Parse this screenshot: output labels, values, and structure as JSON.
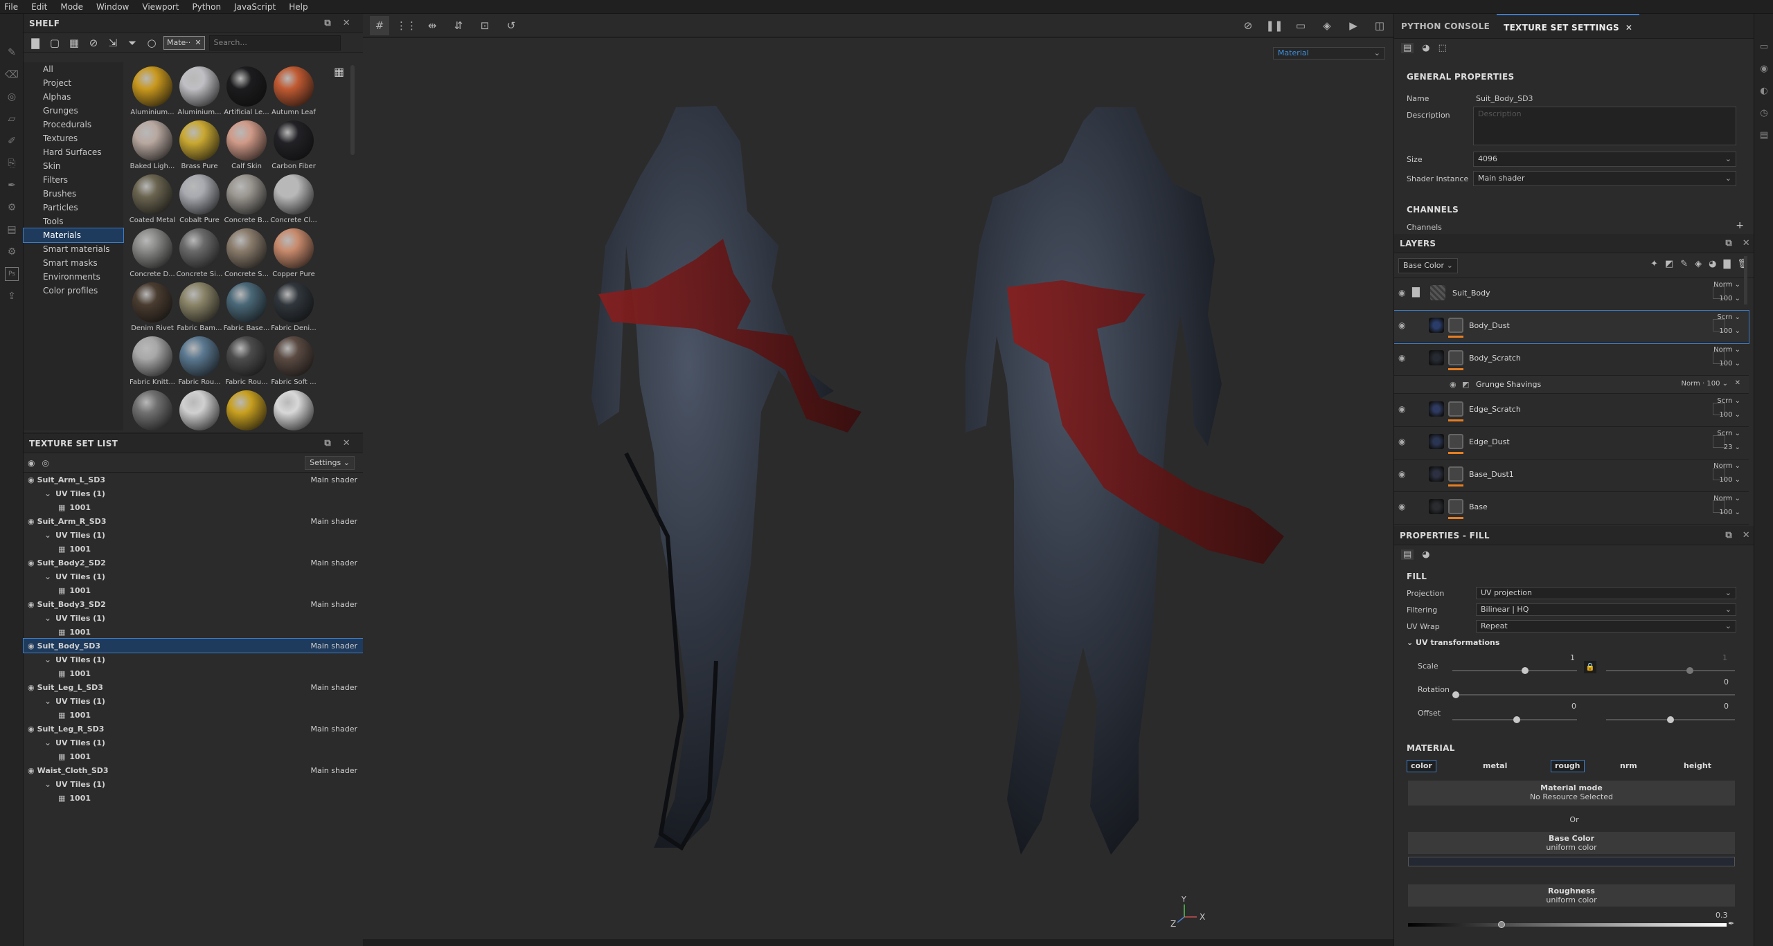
{
  "menu": [
    "File",
    "Edit",
    "Mode",
    "Window",
    "Viewport",
    "Python",
    "JavaScript",
    "Help"
  ],
  "shelf": {
    "title": "SHELF",
    "filter_chip": "Mate··",
    "search_placeholder": "Search...",
    "categories": [
      "All",
      "Project",
      "Alphas",
      "Grunges",
      "Procedurals",
      "Textures",
      "Hard Surfaces",
      "Skin",
      "Filters",
      "Brushes",
      "Particles",
      "Tools",
      "Materials",
      "Smart materials",
      "Smart masks",
      "Environments",
      "Color profiles"
    ],
    "selected_category": "Materials",
    "materials": [
      {
        "label": "Aluminium...",
        "color": "#c9981e"
      },
      {
        "label": "Aluminium...",
        "color": "#c0c0c4"
      },
      {
        "label": "Artificial Le...",
        "color": "#1c1c1e"
      },
      {
        "label": "Autumn Leaf",
        "color": "#c05a32"
      },
      {
        "label": "Baked Ligh...",
        "color": "#b8a8a0"
      },
      {
        "label": "Brass Pure",
        "color": "#c9a832"
      },
      {
        "label": "Calf Skin",
        "color": "#d09a88"
      },
      {
        "label": "Carbon Fiber",
        "color": "#222226"
      },
      {
        "label": "Coated Metal",
        "color": "#6a6450"
      },
      {
        "label": "Cobalt Pure",
        "color": "#a8aab0"
      },
      {
        "label": "Concrete B...",
        "color": "#9a9690"
      },
      {
        "label": "Concrete Cl...",
        "color": "#b8b8b8"
      },
      {
        "label": "Concrete D...",
        "color": "#8a8a88"
      },
      {
        "label": "Concrete Si...",
        "color": "#6a6a6a"
      },
      {
        "label": "Concrete S...",
        "color": "#8a7c6c"
      },
      {
        "label": "Copper Pure",
        "color": "#c88a6c"
      },
      {
        "label": "Denim Rivet",
        "color": "#4a3c30"
      },
      {
        "label": "Fabric Bam...",
        "color": "#8a8468"
      },
      {
        "label": "Fabric Base...",
        "color": "#4a6878"
      },
      {
        "label": "Fabric Deni...",
        "color": "#30363c"
      },
      {
        "label": "Fabric Knitt...",
        "color": "#a8a8a8"
      },
      {
        "label": "Fabric Rou...",
        "color": "#5a7890"
      },
      {
        "label": "Fabric Rou...",
        "color": "#4c4c4c"
      },
      {
        "label": "Fabric Soft ...",
        "color": "#5a4a42"
      },
      {
        "label": "",
        "color": "#707070"
      },
      {
        "label": "",
        "color": "#d0d0d0"
      },
      {
        "label": "",
        "color": "#c8a020"
      },
      {
        "label": "",
        "color": "#d8d8d8"
      }
    ]
  },
  "texture_set_list": {
    "title": "TEXTURE SET LIST",
    "settings_label": "Settings",
    "sets": [
      {
        "name": "Suit_Arm_L_SD3",
        "shader": "Main shader",
        "uv": "UV Tiles (1)",
        "tile": "1001"
      },
      {
        "name": "Suit_Arm_R_SD3",
        "shader": "Main shader",
        "uv": "UV Tiles (1)",
        "tile": "1001"
      },
      {
        "name": "Suit_Body2_SD2",
        "shader": "Main shader",
        "uv": "UV Tiles (1)",
        "tile": "1001"
      },
      {
        "name": "Suit_Body3_SD2",
        "shader": "Main shader",
        "uv": "UV Tiles (1)",
        "tile": "1001"
      },
      {
        "name": "Suit_Body_SD3",
        "shader": "Main shader",
        "uv": "UV Tiles (1)",
        "tile": "1001"
      },
      {
        "name": "Suit_Leg_L_SD3",
        "shader": "Main shader",
        "uv": "UV Tiles (1)",
        "tile": "1001"
      },
      {
        "name": "Suit_Leg_R_SD3",
        "shader": "Main shader",
        "uv": "UV Tiles (1)",
        "tile": "1001"
      },
      {
        "name": "Waist_Cloth_SD3",
        "shader": "Main shader",
        "uv": "UV Tiles (1)",
        "tile": "1001"
      }
    ],
    "selected": "Suit_Body_SD3"
  },
  "viewport": {
    "channel_dropdown": "Material",
    "axis_z": "Z",
    "axis_x": "X",
    "axis_y": "Y"
  },
  "texture_set_settings": {
    "tab_console": "PYTHON CONSOLE",
    "tab_settings": "TEXTURE SET SETTINGS",
    "section_general": "GENERAL PROPERTIES",
    "name_label": "Name",
    "name_value": "Suit_Body_SD3",
    "description_label": "Description",
    "description_placeholder": "Description",
    "size_label": "Size",
    "size_value": "4096",
    "shader_label": "Shader Instance",
    "shader_value": "Main shader",
    "section_channels": "CHANNELS",
    "channels_label": "Channels"
  },
  "layers": {
    "title": "LAYERS",
    "channel": "Base Color",
    "items": [
      {
        "name": "Suit_Body",
        "blend": "Norm",
        "opacity": "100",
        "type": "folder"
      },
      {
        "name": "Body_Dust",
        "blend": "Scrn",
        "opacity": "100",
        "type": "fill",
        "selected": true
      },
      {
        "name": "Body_Scratch",
        "blend": "Norm",
        "opacity": "100",
        "type": "fill"
      },
      {
        "name": "Edge_Scratch",
        "blend": "Scrn",
        "opacity": "100",
        "type": "fill"
      },
      {
        "name": "Edge_Dust",
        "blend": "Scrn",
        "opacity": "23",
        "type": "fill"
      },
      {
        "name": "Base_Dust1",
        "blend": "Norm",
        "opacity": "100",
        "type": "fill"
      },
      {
        "name": "Base",
        "blend": "Norm",
        "opacity": "100",
        "type": "fill"
      }
    ],
    "effect": {
      "name": "Grunge Shavings",
      "blend": "Norm",
      "opacity": "100"
    }
  },
  "properties": {
    "title": "PROPERTIES - FILL",
    "section_fill": "FILL",
    "projection_label": "Projection",
    "projection_value": "UV projection",
    "filtering_label": "Filtering",
    "filtering_value": "Bilinear | HQ",
    "wrap_label": "UV Wrap",
    "wrap_value": "Repeat",
    "uv_transform_label": "UV transformations",
    "scale_label": "Scale",
    "scale_value": "1",
    "scale_value2": "1",
    "rotation_label": "Rotation",
    "rotation_value": "0",
    "offset_label": "Offset",
    "offset_value": "0",
    "offset_value2": "0",
    "section_material": "MATERIAL",
    "channels": [
      "color",
      "metal",
      "rough",
      "nrm",
      "height"
    ],
    "material_mode_label": "Material mode",
    "material_mode_value": "No Resource Selected",
    "or_label": "Or",
    "base_color_label": "Base Color",
    "base_color_value": "uniform color",
    "roughness_label": "Roughness",
    "roughness_value": "uniform color",
    "roughness_num": "0.3"
  }
}
